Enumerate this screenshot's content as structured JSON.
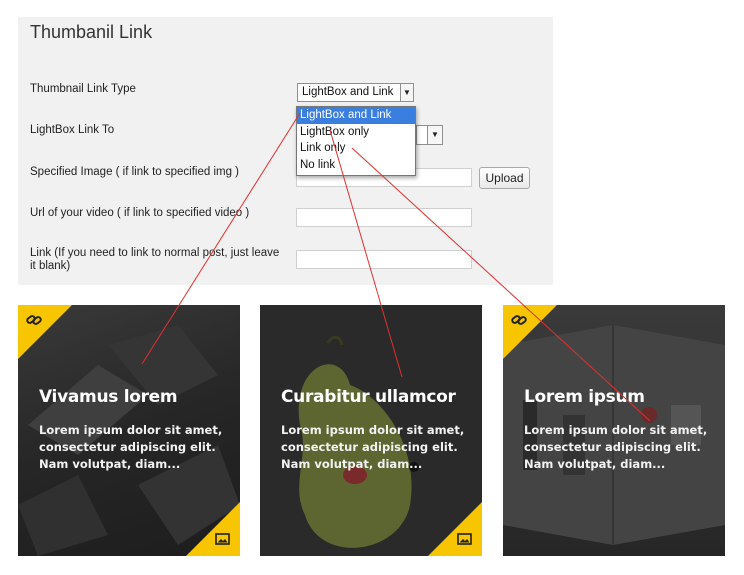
{
  "panel": {
    "title": "Thumbanil Link",
    "rows": {
      "link_type_label": "Thumbnail Link Type",
      "lightbox_link_label": "LightBox Link To",
      "specified_image_label": "Specified Image ( if link to specified img )",
      "video_url_label": "Url of your video ( if link to specified video )",
      "link_label": "Link (If you need to link to normal post, just leave it blank)"
    },
    "link_type_value": "LightBox and Link",
    "upload_label": "Upload",
    "dropdown_options": [
      "LightBox and Link",
      "LightBox only",
      "Link only",
      "No link"
    ],
    "dropdown_selected_index": 0
  },
  "cards": [
    {
      "title": "Vivamus lorem",
      "desc": "Lorem ipsum dolor sit amet, consectetur adipiscing elit. Nam volutpat, diam...",
      "top_icon": "link-icon",
      "bottom_icon": "image-icon"
    },
    {
      "title": "Curabitur ullamcor",
      "desc": "Lorem ipsum dolor sit amet, consectetur adipiscing elit. Nam volutpat, diam...",
      "bottom_icon": "image-icon"
    },
    {
      "title": "Lorem ipsum",
      "desc": "Lorem ipsum dolor sit amet, consectetur adipiscing elit. Nam volutpat, diam...",
      "top_icon": "link-icon"
    }
  ],
  "colors": {
    "accent_yellow": "#f7c600",
    "selected_option": "#3a7ee0",
    "annotation_line": "#e03030"
  }
}
